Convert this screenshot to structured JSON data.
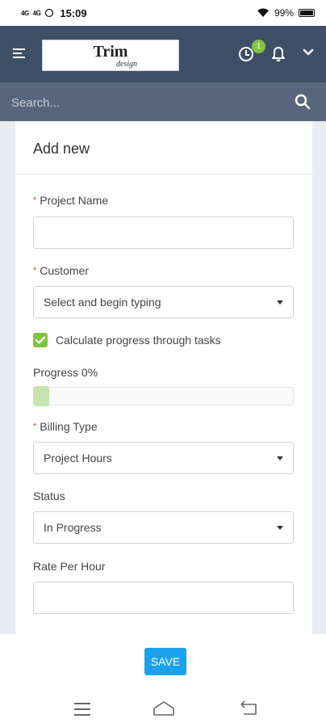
{
  "status_bar": {
    "signal1": "4G",
    "signal2": "4G",
    "time": "15:09",
    "battery": "99%"
  },
  "header": {
    "logo_main": "Trim",
    "logo_sub": "design",
    "notification_count": "1"
  },
  "search": {
    "placeholder": "Search..."
  },
  "form": {
    "title": "Add new",
    "project_name": {
      "label": "Project Name",
      "value": ""
    },
    "customer": {
      "label": "Customer",
      "value": "Select and begin typing"
    },
    "calculate_progress": {
      "label": "Calculate progress through tasks",
      "checked": true
    },
    "progress": {
      "label": "Progress 0%",
      "value": 0
    },
    "billing_type": {
      "label": "Billing Type",
      "value": "Project Hours"
    },
    "status": {
      "label": "Status",
      "value": "In Progress"
    },
    "rate_per_hour": {
      "label": "Rate Per Hour",
      "value": ""
    }
  },
  "footer": {
    "save_label": "SAVE"
  },
  "colors": {
    "header": "#3d5068",
    "search_bar": "#58667b",
    "accent_green": "#84c340",
    "save_blue": "#1aa3ec",
    "required_red": "#e74c3c"
  }
}
